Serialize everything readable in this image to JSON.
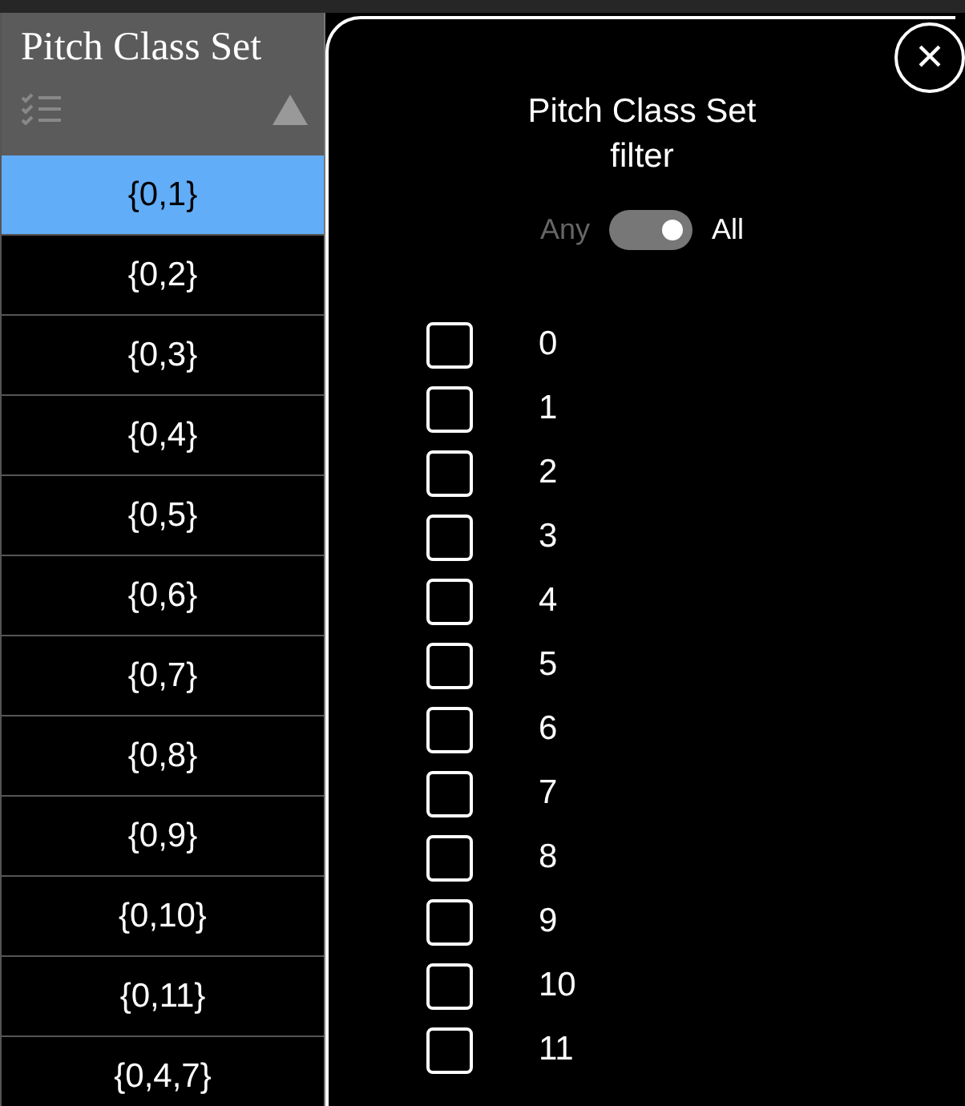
{
  "column": {
    "title": "Pitch Class Set"
  },
  "rows": [
    {
      "label": "{0,1}",
      "selected": true
    },
    {
      "label": "{0,2}",
      "selected": false
    },
    {
      "label": "{0,3}",
      "selected": false
    },
    {
      "label": "{0,4}",
      "selected": false
    },
    {
      "label": "{0,5}",
      "selected": false
    },
    {
      "label": "{0,6}",
      "selected": false
    },
    {
      "label": "{0,7}",
      "selected": false
    },
    {
      "label": "{0,8}",
      "selected": false
    },
    {
      "label": "{0,9}",
      "selected": false
    },
    {
      "label": "{0,10}",
      "selected": false
    },
    {
      "label": "{0,11}",
      "selected": false
    },
    {
      "label": "{0,4,7}",
      "selected": false
    }
  ],
  "filter": {
    "title": "Pitch Class Set filter",
    "close": "×",
    "toggle": {
      "off_label": "Any",
      "on_label": "All",
      "on": true
    },
    "options": [
      {
        "label": "0",
        "checked": false
      },
      {
        "label": "1",
        "checked": false
      },
      {
        "label": "2",
        "checked": false
      },
      {
        "label": "3",
        "checked": false
      },
      {
        "label": "4",
        "checked": false
      },
      {
        "label": "5",
        "checked": false
      },
      {
        "label": "6",
        "checked": false
      },
      {
        "label": "7",
        "checked": false
      },
      {
        "label": "8",
        "checked": false
      },
      {
        "label": "9",
        "checked": false
      },
      {
        "label": "10",
        "checked": false
      },
      {
        "label": "11",
        "checked": false
      }
    ]
  }
}
